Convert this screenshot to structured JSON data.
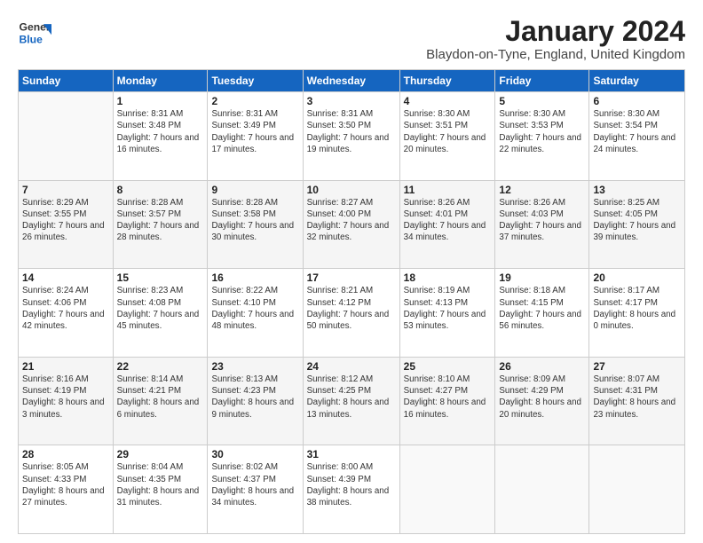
{
  "header": {
    "logo_line1": "General",
    "logo_line2": "Blue",
    "month_title": "January 2024",
    "location": "Blaydon-on-Tyne, England, United Kingdom"
  },
  "days_of_week": [
    "Sunday",
    "Monday",
    "Tuesday",
    "Wednesday",
    "Thursday",
    "Friday",
    "Saturday"
  ],
  "weeks": [
    [
      {
        "day": "",
        "sunrise": "",
        "sunset": "",
        "daylight": ""
      },
      {
        "day": "1",
        "sunrise": "Sunrise: 8:31 AM",
        "sunset": "Sunset: 3:48 PM",
        "daylight": "Daylight: 7 hours and 16 minutes."
      },
      {
        "day": "2",
        "sunrise": "Sunrise: 8:31 AM",
        "sunset": "Sunset: 3:49 PM",
        "daylight": "Daylight: 7 hours and 17 minutes."
      },
      {
        "day": "3",
        "sunrise": "Sunrise: 8:31 AM",
        "sunset": "Sunset: 3:50 PM",
        "daylight": "Daylight: 7 hours and 19 minutes."
      },
      {
        "day": "4",
        "sunrise": "Sunrise: 8:30 AM",
        "sunset": "Sunset: 3:51 PM",
        "daylight": "Daylight: 7 hours and 20 minutes."
      },
      {
        "day": "5",
        "sunrise": "Sunrise: 8:30 AM",
        "sunset": "Sunset: 3:53 PM",
        "daylight": "Daylight: 7 hours and 22 minutes."
      },
      {
        "day": "6",
        "sunrise": "Sunrise: 8:30 AM",
        "sunset": "Sunset: 3:54 PM",
        "daylight": "Daylight: 7 hours and 24 minutes."
      }
    ],
    [
      {
        "day": "7",
        "sunrise": "Sunrise: 8:29 AM",
        "sunset": "Sunset: 3:55 PM",
        "daylight": "Daylight: 7 hours and 26 minutes."
      },
      {
        "day": "8",
        "sunrise": "Sunrise: 8:28 AM",
        "sunset": "Sunset: 3:57 PM",
        "daylight": "Daylight: 7 hours and 28 minutes."
      },
      {
        "day": "9",
        "sunrise": "Sunrise: 8:28 AM",
        "sunset": "Sunset: 3:58 PM",
        "daylight": "Daylight: 7 hours and 30 minutes."
      },
      {
        "day": "10",
        "sunrise": "Sunrise: 8:27 AM",
        "sunset": "Sunset: 4:00 PM",
        "daylight": "Daylight: 7 hours and 32 minutes."
      },
      {
        "day": "11",
        "sunrise": "Sunrise: 8:26 AM",
        "sunset": "Sunset: 4:01 PM",
        "daylight": "Daylight: 7 hours and 34 minutes."
      },
      {
        "day": "12",
        "sunrise": "Sunrise: 8:26 AM",
        "sunset": "Sunset: 4:03 PM",
        "daylight": "Daylight: 7 hours and 37 minutes."
      },
      {
        "day": "13",
        "sunrise": "Sunrise: 8:25 AM",
        "sunset": "Sunset: 4:05 PM",
        "daylight": "Daylight: 7 hours and 39 minutes."
      }
    ],
    [
      {
        "day": "14",
        "sunrise": "Sunrise: 8:24 AM",
        "sunset": "Sunset: 4:06 PM",
        "daylight": "Daylight: 7 hours and 42 minutes."
      },
      {
        "day": "15",
        "sunrise": "Sunrise: 8:23 AM",
        "sunset": "Sunset: 4:08 PM",
        "daylight": "Daylight: 7 hours and 45 minutes."
      },
      {
        "day": "16",
        "sunrise": "Sunrise: 8:22 AM",
        "sunset": "Sunset: 4:10 PM",
        "daylight": "Daylight: 7 hours and 48 minutes."
      },
      {
        "day": "17",
        "sunrise": "Sunrise: 8:21 AM",
        "sunset": "Sunset: 4:12 PM",
        "daylight": "Daylight: 7 hours and 50 minutes."
      },
      {
        "day": "18",
        "sunrise": "Sunrise: 8:19 AM",
        "sunset": "Sunset: 4:13 PM",
        "daylight": "Daylight: 7 hours and 53 minutes."
      },
      {
        "day": "19",
        "sunrise": "Sunrise: 8:18 AM",
        "sunset": "Sunset: 4:15 PM",
        "daylight": "Daylight: 7 hours and 56 minutes."
      },
      {
        "day": "20",
        "sunrise": "Sunrise: 8:17 AM",
        "sunset": "Sunset: 4:17 PM",
        "daylight": "Daylight: 8 hours and 0 minutes."
      }
    ],
    [
      {
        "day": "21",
        "sunrise": "Sunrise: 8:16 AM",
        "sunset": "Sunset: 4:19 PM",
        "daylight": "Daylight: 8 hours and 3 minutes."
      },
      {
        "day": "22",
        "sunrise": "Sunrise: 8:14 AM",
        "sunset": "Sunset: 4:21 PM",
        "daylight": "Daylight: 8 hours and 6 minutes."
      },
      {
        "day": "23",
        "sunrise": "Sunrise: 8:13 AM",
        "sunset": "Sunset: 4:23 PM",
        "daylight": "Daylight: 8 hours and 9 minutes."
      },
      {
        "day": "24",
        "sunrise": "Sunrise: 8:12 AM",
        "sunset": "Sunset: 4:25 PM",
        "daylight": "Daylight: 8 hours and 13 minutes."
      },
      {
        "day": "25",
        "sunrise": "Sunrise: 8:10 AM",
        "sunset": "Sunset: 4:27 PM",
        "daylight": "Daylight: 8 hours and 16 minutes."
      },
      {
        "day": "26",
        "sunrise": "Sunrise: 8:09 AM",
        "sunset": "Sunset: 4:29 PM",
        "daylight": "Daylight: 8 hours and 20 minutes."
      },
      {
        "day": "27",
        "sunrise": "Sunrise: 8:07 AM",
        "sunset": "Sunset: 4:31 PM",
        "daylight": "Daylight: 8 hours and 23 minutes."
      }
    ],
    [
      {
        "day": "28",
        "sunrise": "Sunrise: 8:05 AM",
        "sunset": "Sunset: 4:33 PM",
        "daylight": "Daylight: 8 hours and 27 minutes."
      },
      {
        "day": "29",
        "sunrise": "Sunrise: 8:04 AM",
        "sunset": "Sunset: 4:35 PM",
        "daylight": "Daylight: 8 hours and 31 minutes."
      },
      {
        "day": "30",
        "sunrise": "Sunrise: 8:02 AM",
        "sunset": "Sunset: 4:37 PM",
        "daylight": "Daylight: 8 hours and 34 minutes."
      },
      {
        "day": "31",
        "sunrise": "Sunrise: 8:00 AM",
        "sunset": "Sunset: 4:39 PM",
        "daylight": "Daylight: 8 hours and 38 minutes."
      },
      {
        "day": "",
        "sunrise": "",
        "sunset": "",
        "daylight": ""
      },
      {
        "day": "",
        "sunrise": "",
        "sunset": "",
        "daylight": ""
      },
      {
        "day": "",
        "sunrise": "",
        "sunset": "",
        "daylight": ""
      }
    ]
  ]
}
